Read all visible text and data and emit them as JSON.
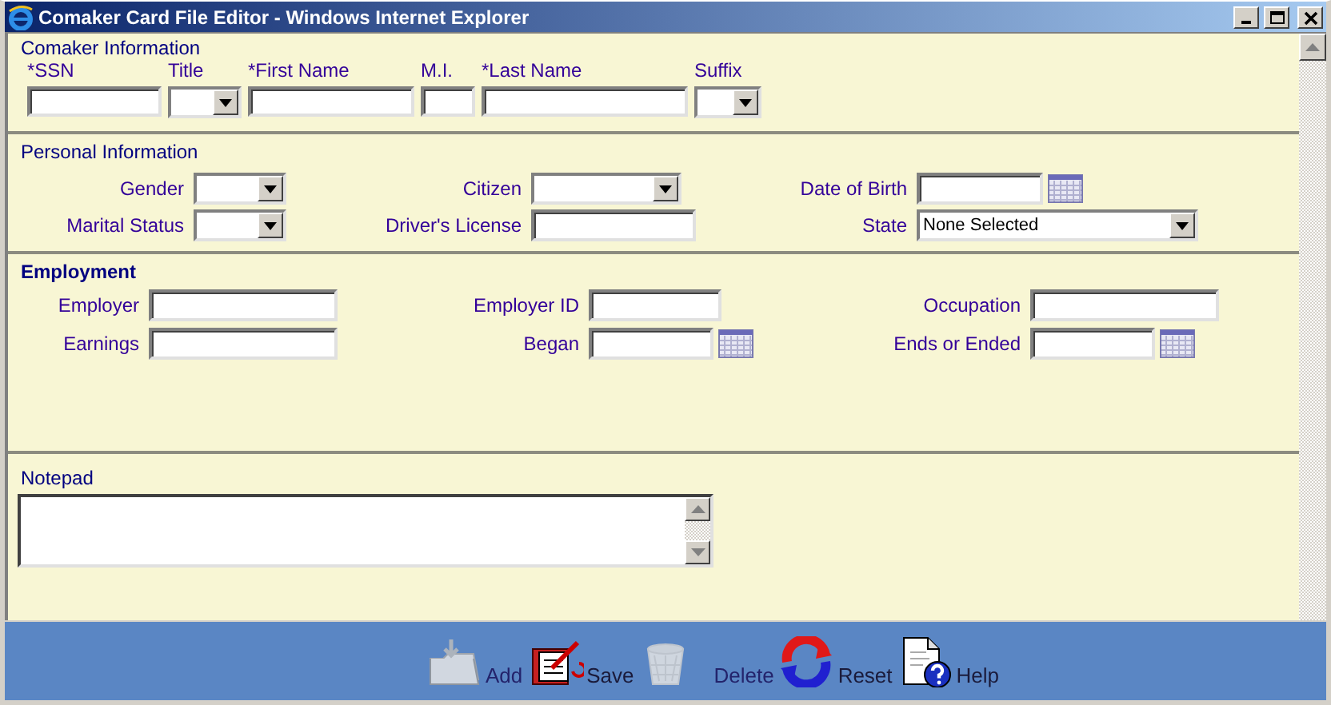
{
  "window": {
    "title": "Comaker Card File Editor - Windows Internet Explorer"
  },
  "comaker": {
    "title": "Comaker Information",
    "fields": [
      {
        "label": "*SSN",
        "kind": "text"
      },
      {
        "label": "Title",
        "kind": "select"
      },
      {
        "label": "*First Name",
        "kind": "text"
      },
      {
        "label": "M.I.",
        "kind": "text"
      },
      {
        "label": "*Last Name",
        "kind": "text"
      },
      {
        "label": "Suffix",
        "kind": "select"
      }
    ]
  },
  "personal": {
    "title": "Personal Information",
    "bold": false,
    "rows": [
      [
        {
          "label": "Gender",
          "kind": "select"
        },
        {
          "label": "Citizen",
          "kind": "select"
        },
        {
          "label": "Date of Birth",
          "kind": "date"
        }
      ],
      [
        {
          "label": "Marital Status",
          "kind": "select"
        },
        {
          "label": "Driver's License",
          "kind": "text"
        },
        {
          "label": "State",
          "kind": "select",
          "value": "None Selected"
        }
      ]
    ]
  },
  "employment": {
    "title": "Employment",
    "bold": true,
    "rows": [
      [
        {
          "label": "Employer",
          "kind": "text"
        },
        {
          "label": "Employer ID",
          "kind": "text"
        },
        {
          "label": "Occupation",
          "kind": "text"
        }
      ],
      [
        {
          "label": "Earnings",
          "kind": "text"
        },
        {
          "label": "Began",
          "kind": "date"
        },
        {
          "label": "Ends or Ended",
          "kind": "date"
        }
      ]
    ]
  },
  "notepad": {
    "title": "Notepad"
  },
  "toolbar": [
    {
      "label": "Add",
      "kind": "add",
      "disabled": true
    },
    {
      "label": "Save",
      "kind": "save",
      "disabled": false
    },
    {
      "label": "Delete",
      "kind": "delete",
      "disabled": true
    },
    {
      "label": "Reset",
      "kind": "reset",
      "disabled": false
    },
    {
      "label": "Help",
      "kind": "help",
      "disabled": false
    }
  ]
}
